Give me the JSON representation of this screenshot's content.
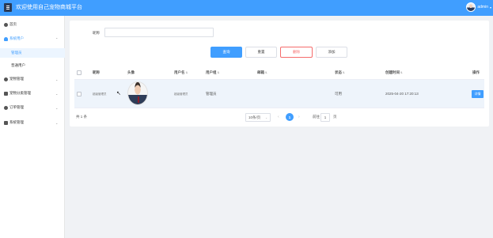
{
  "header": {
    "title": "欢迎使用自己宠物商城平台",
    "user_name": "admin",
    "menu_icon": "hamburger-menu-icon",
    "caret_icon": "caret-down-icon"
  },
  "sidebar": {
    "items": [
      {
        "label": "首页",
        "icon": "gear-icon"
      },
      {
        "label": "系统用户",
        "icon": "user-icon",
        "expanded": true
      },
      {
        "label": "管理员",
        "sub": true,
        "active": true
      },
      {
        "label": "普通用户",
        "sub": true
      },
      {
        "label": "宠物管理",
        "icon": "paw-icon"
      },
      {
        "label": "宠物分类管理",
        "icon": "category-icon"
      },
      {
        "label": "订单管理",
        "icon": "order-icon"
      },
      {
        "label": "系统管理",
        "icon": "settings-icon"
      }
    ],
    "chevron": "⌄"
  },
  "search": {
    "label": "昵称",
    "value": "",
    "placeholder": ""
  },
  "toolbar": {
    "search_label": "查询",
    "reset_label": "重置",
    "delete_label": "删除",
    "add_label": "添加"
  },
  "table": {
    "headers": [
      "昵称",
      "头像",
      "用户名",
      "用户组",
      "邮箱",
      "状态",
      "创建时间",
      "操作"
    ],
    "rows": [
      {
        "nickname": "超级管理员",
        "username": "超级管理员",
        "group": "管理员",
        "email": "",
        "status": "可用",
        "created": "2025-04-20 17:20:13",
        "action": "详情"
      }
    ]
  },
  "pagination": {
    "total": "共 1 条",
    "page_size": "10条/页",
    "current": "1",
    "goto_label": "前往",
    "goto_value": "1",
    "goto_unit": "页"
  },
  "colors": {
    "primary": "#409eff",
    "danger": "#f56c6c",
    "row_highlight": "#eef4fb"
  }
}
